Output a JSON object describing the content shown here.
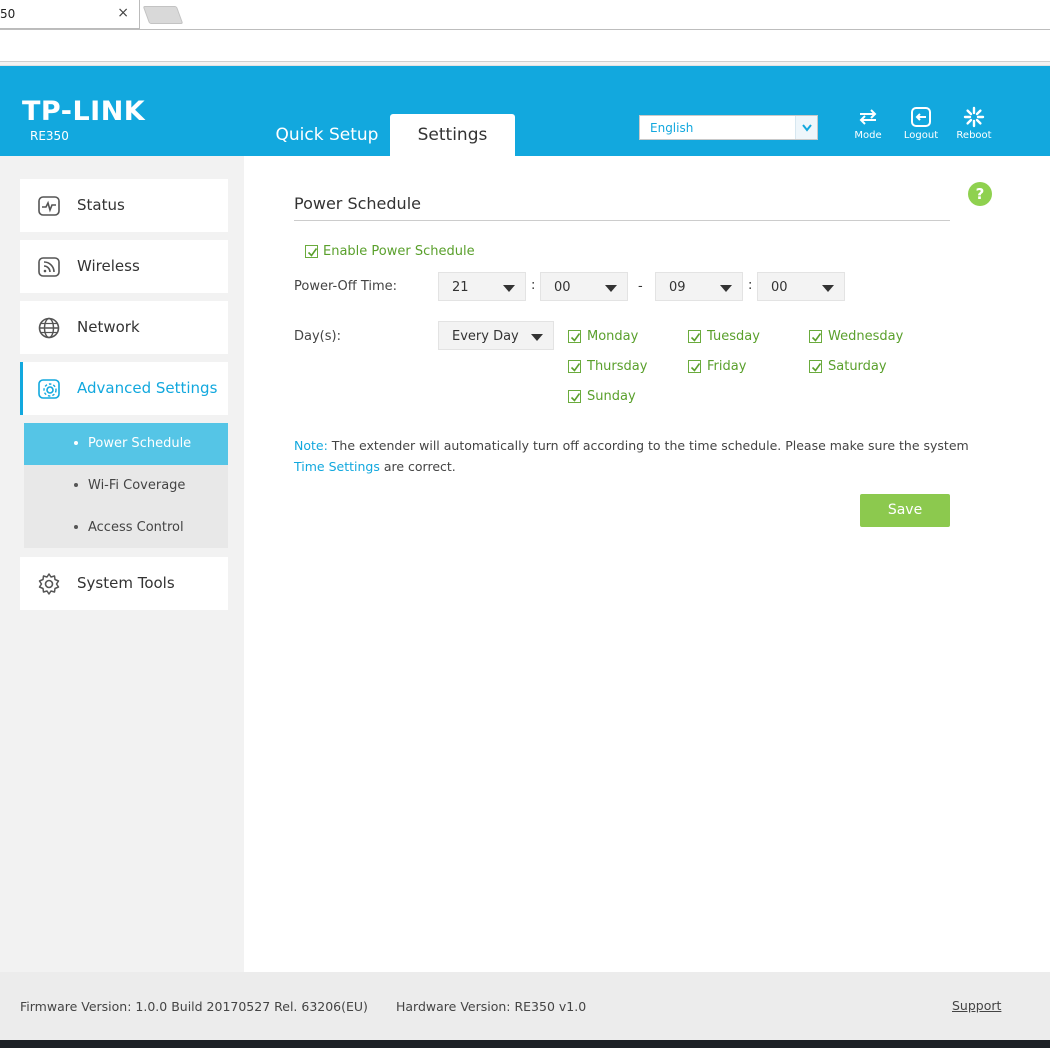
{
  "browser": {
    "tab_title": "50",
    "tab_close": "×"
  },
  "header": {
    "logo": "TP-LINK",
    "model": "RE350",
    "tabs": [
      {
        "label": "Quick Setup",
        "active": false
      },
      {
        "label": "Settings",
        "active": true
      }
    ],
    "language": {
      "selected": "English"
    },
    "buttons": [
      {
        "label": "Mode",
        "icon": "mode-icon"
      },
      {
        "label": "Logout",
        "icon": "logout-icon"
      },
      {
        "label": "Reboot",
        "icon": "reboot-icon"
      }
    ],
    "colors": {
      "brand": "#12a8de"
    }
  },
  "sidebar": {
    "items": [
      {
        "label": "Status",
        "icon": "status-icon"
      },
      {
        "label": "Wireless",
        "icon": "wireless-icon"
      },
      {
        "label": "Network",
        "icon": "network-icon"
      },
      {
        "label": "Advanced Settings",
        "icon": "advanced-settings-icon",
        "active": true
      },
      {
        "label": "System Tools",
        "icon": "system-tools-icon"
      }
    ],
    "submenu": [
      {
        "label": "Power Schedule",
        "active": true
      },
      {
        "label": "Wi-Fi Coverage"
      },
      {
        "label": "Access Control"
      }
    ]
  },
  "main": {
    "help": "?",
    "title": "Power Schedule",
    "enable_label": "Enable Power Schedule",
    "enable_checked": true,
    "power_off_label": "Power-Off Time:",
    "start_hour": "21",
    "start_minute": "00",
    "end_hour": "09",
    "end_minute": "00",
    "colon": ":",
    "dash": "-",
    "days_label": "Day(s):",
    "days_mode": "Every Day",
    "days": [
      {
        "label": "Monday",
        "checked": true
      },
      {
        "label": "Tuesday",
        "checked": true
      },
      {
        "label": "Wednesday",
        "checked": true
      },
      {
        "label": "Thursday",
        "checked": true
      },
      {
        "label": "Friday",
        "checked": true
      },
      {
        "label": "Saturday",
        "checked": true
      },
      {
        "label": "Sunday",
        "checked": true
      }
    ],
    "note_label": "Note:",
    "note_text": "The extender will automatically turn off according to the time schedule. Please make sure the system",
    "note_link": "Time Settings",
    "note_tail": "are correct.",
    "save_label": "Save",
    "colors": {
      "accent": "#8cc94e",
      "check": "#5aa02c"
    }
  },
  "footer": {
    "firmware": "Firmware Version: 1.0.0 Build 20170527 Rel. 63206(EU)",
    "hardware": "Hardware Version: RE350 v1.0",
    "support": "Support"
  }
}
